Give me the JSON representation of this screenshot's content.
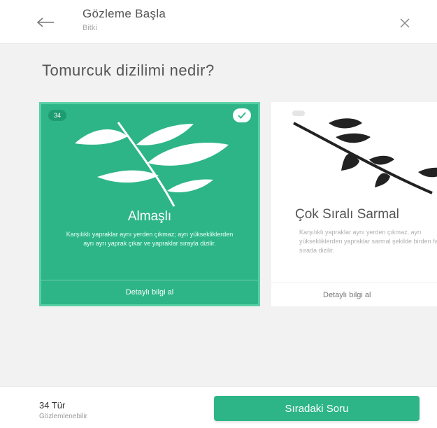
{
  "header": {
    "title": "Gözleme Başla",
    "subtitle": "Bitki",
    "back_icon": "arrow-left-icon",
    "close_icon": "close-icon"
  },
  "question": "Tomurcuk dizilimi nedir?",
  "cards": [
    {
      "title": "Almaşlı",
      "description": "Karşılıklı yapraklar aynı yerden çıkmaz; ayrı yüksekliklerden ayrı ayrı yaprak çıkar ve yapraklar sırayla dizilir.",
      "link": "Detaylı bilgi al",
      "badge": "34",
      "selected": true,
      "image_icon": "alternate-leaf-branch-icon"
    },
    {
      "title": "Çok Sıralı Sarmal",
      "description": "Karşılıklı yapraklar aynı yerden çıkmaz, ayrı yüksekliklerden yapraklar sarmal şekilde birden fazla sırada dizilir.",
      "link": "Detaylı bilgi al",
      "selected": false,
      "image_icon": "spiral-leaf-branch-icon"
    }
  ],
  "footer": {
    "score_value": "34 Tür",
    "score_label": "Gözlemlenebilir",
    "next_button": "Sıradaki Soru"
  },
  "colors": {
    "accent": "#2db588",
    "accent_border": "#58cfa4"
  }
}
